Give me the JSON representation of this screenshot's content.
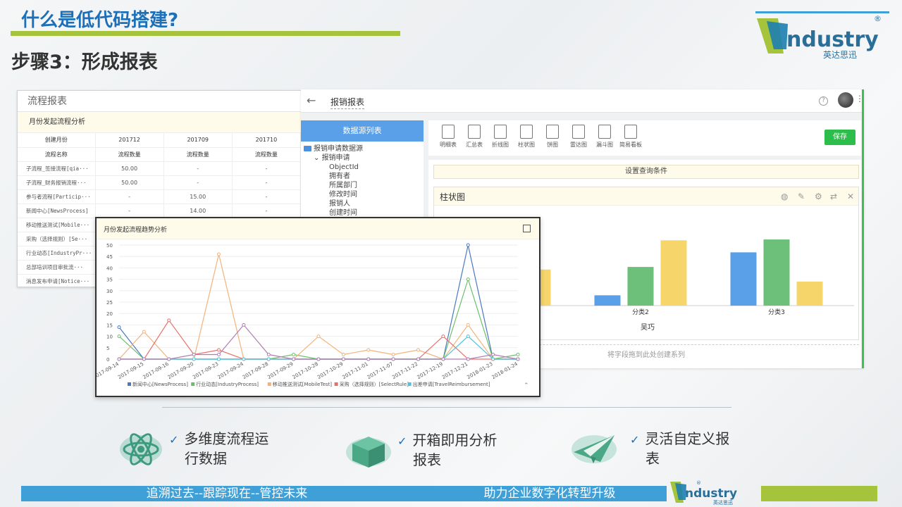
{
  "slide": {
    "title": "什么是低代码搭建?",
    "step_title": "步骤3：形成报表",
    "accent_blue": "#1d6fb8",
    "accent_green": "#a6c43b"
  },
  "logo": {
    "brand": "ndustry",
    "sub": "英达思迅"
  },
  "table_window": {
    "title": "流程报表",
    "subtitle": "月份发起流程分析",
    "header_row": [
      "创建月份",
      "201712",
      "201709",
      "201710"
    ],
    "sub_header_row": [
      "流程名称",
      "流程数量",
      "流程数量",
      "流程数量"
    ],
    "rows": [
      [
        "子流程_签接流程[qia···",
        "50.00",
        "-",
        "-"
      ],
      [
        "子流程_财务报销流程···",
        "50.00",
        "-",
        "-"
      ],
      [
        "参与者流程[Particip···",
        "-",
        "15.00",
        "-"
      ],
      [
        "新闻中心[NewsProcess]",
        "-",
        "14.00",
        "-"
      ],
      [
        "移动推送测试[Mobile···",
        "",
        "",
        ""
      ],
      [
        "采购（选择规则）[Se···",
        "",
        "",
        ""
      ],
      [
        "行业动态[IndustryPr···",
        "",
        "",
        ""
      ],
      [
        "总部培训项目审批流···",
        "",
        "",
        ""
      ],
      [
        "消息发布申请[Notice···",
        "",
        "",
        ""
      ]
    ]
  },
  "designer": {
    "title": "报销报表",
    "data_source_header": "数据源列表",
    "tree": {
      "root": "报销申请数据源",
      "child": "报销申请",
      "fields": [
        "ObjectId",
        "拥有者",
        "所属部门",
        "修改时间",
        "报销人",
        "创建时间"
      ]
    },
    "tools": [
      "明细表",
      "汇总表",
      "折线图",
      "柱状图",
      "饼图",
      "雷达图",
      "漏斗图",
      "简易看板"
    ],
    "save_label": "保存",
    "condition_label": "设置查询条件",
    "chart_title": "柱状图",
    "drop_hint": "将字段拖到此处创建系列",
    "help_glyph": "?"
  },
  "trend_window": {
    "title": "月份发起流程趋势分析"
  },
  "features": [
    {
      "line1": "多维度流程运",
      "line2": "行数据"
    },
    {
      "line1": "开箱即用分析",
      "line2": "报表"
    },
    {
      "line1": "灵活自定义报",
      "line2": "表"
    }
  ],
  "footer": {
    "left": "追溯过去--跟踪现在--管控未来",
    "mid": "助力企业数字化转型升级"
  },
  "chart_data": [
    {
      "type": "bar",
      "title": "柱状图",
      "categories": [
        "",
        "分类2",
        "分类3"
      ],
      "xlabel": "吴巧",
      "ylim": [
        0,
        100
      ],
      "yticks": [
        100
      ],
      "series": [
        {
          "values": [
            null,
            12,
            62
          ],
          "color": "#5aa0e8"
        },
        {
          "values": [
            null,
            45,
            77
          ],
          "color": "#6cc07a"
        },
        {
          "values": [
            42,
            76,
            28
          ],
          "color": "#f6d56b"
        }
      ]
    },
    {
      "type": "line",
      "title": "月份发起流程趋势分析",
      "x": [
        "2017-09-14",
        "2017-09-15",
        "2017-09-16",
        "2017-09-20",
        "2017-09-23",
        "2017-09-24",
        "2017-09-28",
        "2017-09-29",
        "2017-10-28",
        "2017-10-29",
        "2017-11-01",
        "2017-11-07",
        "2017-11-22",
        "2017-12-19",
        "2017-12-21",
        "2018-01-23",
        "2018-01-24"
      ],
      "ylim": [
        0,
        50
      ],
      "yticks": [
        0,
        5,
        10,
        15,
        20,
        25,
        30,
        35,
        40,
        45,
        50
      ],
      "series": [
        {
          "name": "新闻中心[NewsProcess]",
          "color": "#4a78c2",
          "values": [
            14,
            0,
            0,
            0,
            0,
            0,
            0,
            0,
            0,
            0,
            0,
            0,
            0,
            0,
            50,
            0,
            0
          ]
        },
        {
          "name": "行业动态[IndustryProcess]",
          "color": "#6bbf6b",
          "values": [
            10,
            0,
            0,
            0,
            0,
            0,
            0,
            2,
            0,
            0,
            0,
            0,
            0,
            0,
            35,
            0,
            2
          ]
        },
        {
          "name": "移动推送测试[MobileTest]",
          "color": "#f2b37a",
          "values": [
            0,
            12,
            0,
            0,
            46,
            0,
            0,
            0,
            10,
            2,
            4,
            2,
            4,
            0,
            15,
            0,
            0
          ]
        },
        {
          "name": "采购（选择规则）[SelectRule]",
          "color": "#e8706a",
          "values": [
            0,
            0,
            17,
            2,
            4,
            0,
            0,
            0,
            0,
            0,
            0,
            0,
            0,
            10,
            0,
            0,
            0
          ]
        },
        {
          "name": "出差申请[TravelReimbursement]",
          "color": "#4cc3e0",
          "values": [
            0,
            0,
            0,
            0,
            0,
            0,
            0,
            0,
            0,
            0,
            0,
            0,
            0,
            0,
            10,
            0,
            0
          ]
        },
        {
          "color": "#b27bb3",
          "values": [
            0,
            0,
            0,
            2,
            2,
            15,
            2,
            0,
            0,
            0,
            0,
            0,
            0,
            0,
            0,
            2,
            0
          ]
        }
      ]
    }
  ]
}
